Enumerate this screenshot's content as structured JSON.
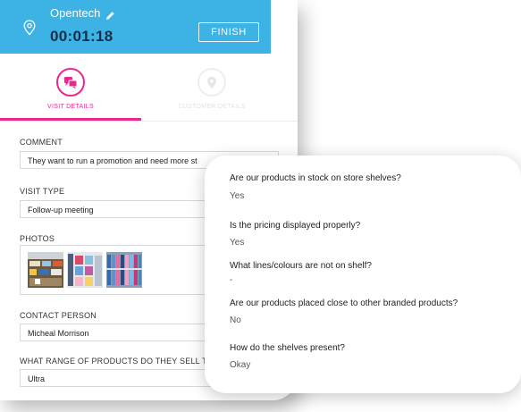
{
  "header": {
    "app_title": "Opentech",
    "timer": "00:01:18",
    "finish_label": "FINISH"
  },
  "tabs": [
    {
      "label": "VISIT DETAILS",
      "icon": "chat-bubbles-icon",
      "active": true
    },
    {
      "label": "CUSTOMER DETAILS",
      "icon": "location-pin-icon",
      "active": false
    }
  ],
  "form": {
    "comment": {
      "label": "COMMENT",
      "value": "They want to run a promotion and need more st"
    },
    "visit_type": {
      "label": "VISIT TYPE",
      "value": "Follow-up meeting"
    },
    "photos": {
      "label": "PHOTOS",
      "count": 3
    },
    "contact_person": {
      "label": "CONTACT PERSON",
      "value": "Micheal Morrison"
    },
    "range": {
      "label": "WHAT RANGE OF PRODUCTS DO THEY SELL T",
      "value": "Ultra"
    }
  },
  "answers": [
    {
      "question": "Are our products in stock on store shelves?",
      "answer": "Yes"
    },
    {
      "question": "Is the pricing displayed properly?",
      "answer": "Yes"
    },
    {
      "question": "What lines/colours are not on shelf?",
      "answer": "-"
    },
    {
      "question": "Are our products placed close to other branded products?",
      "answer": "No"
    },
    {
      "question": "How do the shelves present?",
      "answer": "Okay"
    }
  ],
  "colors": {
    "header_blue": "#3cb3e4",
    "accent_pink": "#e9288d",
    "timer_navy": "#13304a"
  }
}
